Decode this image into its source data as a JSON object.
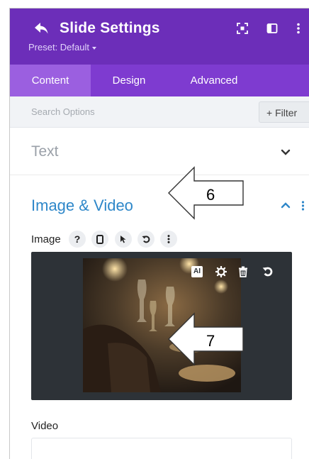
{
  "header": {
    "title": "Slide Settings",
    "preset_label": "Preset: Default",
    "bg_color": "#6c2eb9"
  },
  "tabs": [
    {
      "label": "Content",
      "active": true
    },
    {
      "label": "Design",
      "active": false
    },
    {
      "label": "Advanced",
      "active": false
    }
  ],
  "search": {
    "placeholder": "Search Options",
    "filter_label": "+ Filter"
  },
  "sections": {
    "text": {
      "title": "Text",
      "state": "collapsed"
    },
    "image_video": {
      "title": "Image & Video",
      "state": "expanded",
      "accent": "#2e87c9"
    }
  },
  "image_field": {
    "label": "Image",
    "help_glyph": "?",
    "toolbar_icons": [
      "help-icon",
      "device-icon",
      "pointer-icon",
      "undo-icon",
      "more-icon"
    ],
    "overlay_icons": [
      "ai-icon",
      "gear-icon",
      "trash-icon",
      "undo-icon"
    ],
    "ai_badge": "AI"
  },
  "video_field": {
    "label": "Video",
    "value": ""
  },
  "annotations": [
    {
      "number": "6",
      "target": "image-video-section"
    },
    {
      "number": "7",
      "target": "image-preview"
    }
  ]
}
